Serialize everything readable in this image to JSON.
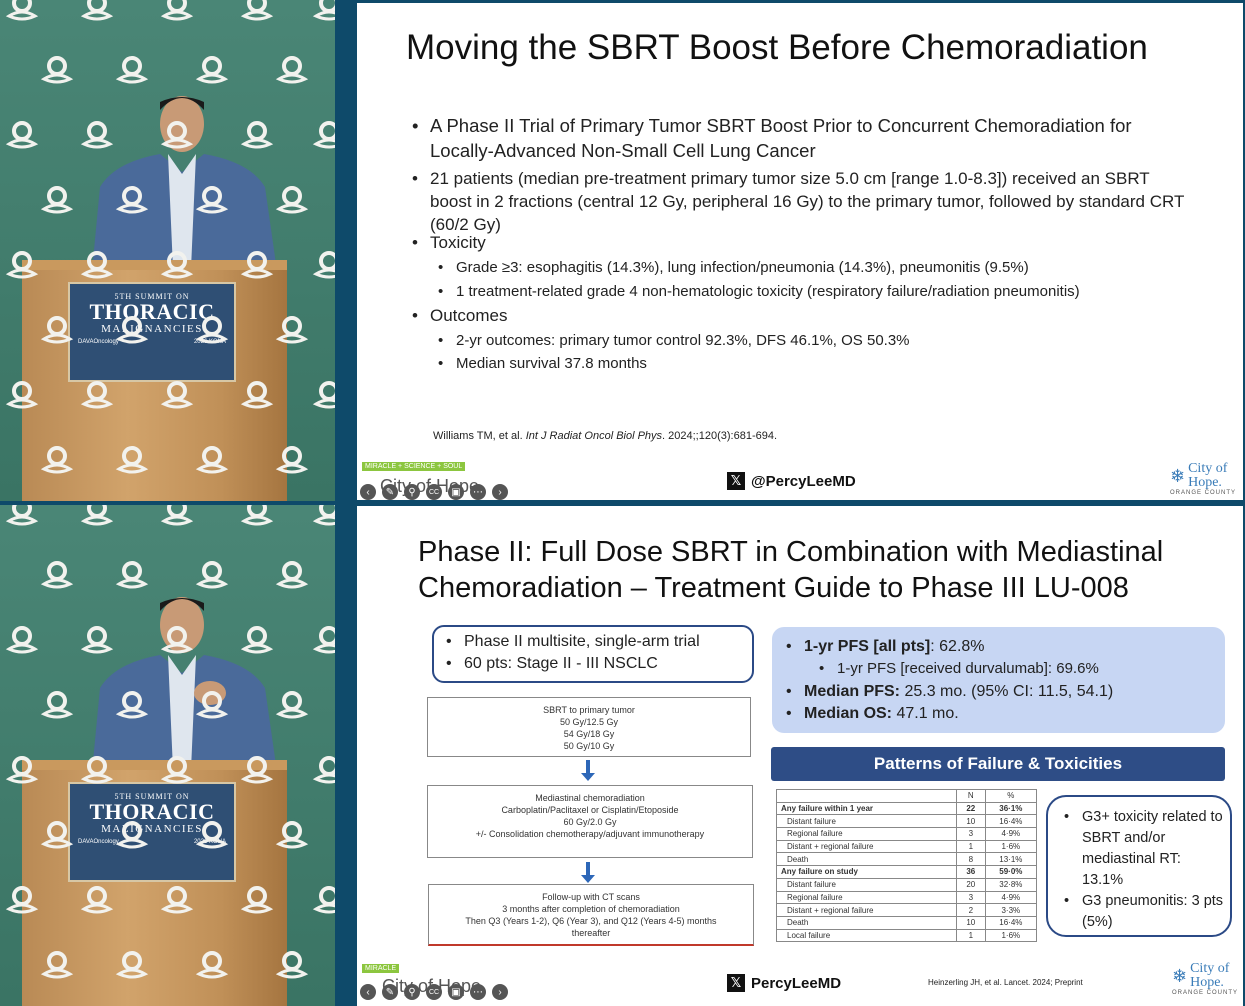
{
  "conference_sign": {
    "line1": "5TH SUMMIT ON",
    "line2": "THORACIC",
    "line3": "MALIGNANCIES",
    "left_logo": "DAVAOncology",
    "right_logo": "2026 KONA"
  },
  "slide1": {
    "title": "Moving the SBRT Boost Before Chemoradiation",
    "bullets": [
      {
        "level": 0,
        "text": "A Phase II Trial of Primary Tumor SBRT Boost Prior to Concurrent Chemoradiation for Locally-Advanced Non-Small Cell Lung Cancer"
      },
      {
        "level": 0,
        "text": "21 patients (median pre-treatment primary tumor size 5.0 cm [range 1.0-8.3]) received an SBRT boost in 2 fractions (central 12 Gy, peripheral 16 Gy) to the primary tumor, followed by standard CRT (60/2 Gy)"
      },
      {
        "level": 0,
        "text": "Toxicity"
      },
      {
        "level": 1,
        "text": "Grade ≥3: esophagitis (14.3%), lung infection/pneumonia (14.3%), pneumonitis (9.5%)"
      },
      {
        "level": 1,
        "text": "1 treatment-related grade 4 non-hematologic toxicity (respiratory failure/radiation pneumonitis)"
      },
      {
        "level": 0,
        "text": "Outcomes"
      },
      {
        "level": 1,
        "text": "2-yr outcomes: primary tumor control 92.3%, DFS 46.1%, OS 50.3%"
      },
      {
        "level": 1,
        "text": "Median survival 37.8 months"
      }
    ],
    "citation_authors": "Williams TM, et al. ",
    "citation_journal": "Int J Radiat Oncol Biol Phys",
    "citation_rest": ". 2024;;120(3):681-694.",
    "handle": "@PercyLeeMD",
    "tagline": "MIRACLE + SCIENCE + SOUL",
    "overlay_text": "City of Hope"
  },
  "slide2": {
    "title_line1": "Phase II: Full Dose SBRT in Combination with Mediastinal",
    "title_line2": "Chemoradiation – Treatment Guide to Phase III LU-008",
    "trial_bullets": [
      "Phase II multisite, single-arm trial",
      "60 pts: Stage II -  III NSCLC"
    ],
    "flow1": [
      "SBRT to primary tumor",
      "50 Gy/12.5 Gy",
      "54 Gy/18 Gy",
      "50 Gy/10 Gy"
    ],
    "flow2": [
      "Mediastinal chemoradiation",
      "Carboplatin/Paclitaxel or Cisplatin/Etoposide",
      "60 Gy/2.0 Gy",
      "+/- Consolidation chemotherapy/adjuvant immunotherapy"
    ],
    "flow3": [
      "Follow-up with CT scans",
      "3 months after completion of chemoradiation",
      "Then Q3 (Years 1-2), Q6 (Year 3), and Q12 (Years 4-5) months",
      "thereafter"
    ],
    "results": [
      {
        "bold": "1-yr PFS [all pts]",
        "rest": ": 62.8%",
        "level": 0
      },
      {
        "bold": "",
        "rest": "1-yr PFS [received durvalumab]: 69.6%",
        "level": 1
      },
      {
        "bold": "Median PFS:",
        "rest": " 25.3 mo. (95% CI: 11.5, 54.1)",
        "level": 0
      },
      {
        "bold": "Median OS:",
        "rest": " 47.1 mo.",
        "level": 0
      }
    ],
    "banner": "Patterns of Failure & Toxicities",
    "table_headers": [
      "",
      "N",
      "%"
    ],
    "table_rows": [
      {
        "label": "Any failure within 1 year",
        "n": "22",
        "p": "36·1%",
        "bold": true
      },
      {
        "label": "Distant failure",
        "n": "10",
        "p": "16·4%",
        "bold": false
      },
      {
        "label": "Regional failure",
        "n": "3",
        "p": "4·9%",
        "bold": false
      },
      {
        "label": "Distant + regional failure",
        "n": "1",
        "p": "1·6%",
        "bold": false
      },
      {
        "label": "Death",
        "n": "8",
        "p": "13·1%",
        "bold": false
      },
      {
        "label": "Any failure on study",
        "n": "36",
        "p": "59·0%",
        "bold": true
      },
      {
        "label": "Distant failure",
        "n": "20",
        "p": "32·8%",
        "bold": false
      },
      {
        "label": "Regional failure",
        "n": "3",
        "p": "4·9%",
        "bold": false
      },
      {
        "label": "Distant + regional failure",
        "n": "2",
        "p": "3·3%",
        "bold": false
      },
      {
        "label": "Death",
        "n": "10",
        "p": "16·4%",
        "bold": false
      },
      {
        "label": "Local failure",
        "n": "1",
        "p": "1·6%",
        "bold": false
      }
    ],
    "tox_bullets": [
      "G3+ toxicity related to SBRT and/or mediastinal RT: 13.1%",
      "G3 pneumonitis: 3 pts (5%)"
    ],
    "citation": "Heinzerling JH, et al. Lancet. 2024; Preprint",
    "handle": "PercyLeeMD",
    "overlay_text": "City of Hope"
  },
  "city_of_hope": {
    "name1": "City of",
    "name2": "Hope.",
    "sub": "ORANGE COUNTY"
  },
  "colors": {
    "accent": "#2e4d86",
    "results_fill": "#c7d6f3",
    "backdrop": "#4a8676"
  }
}
